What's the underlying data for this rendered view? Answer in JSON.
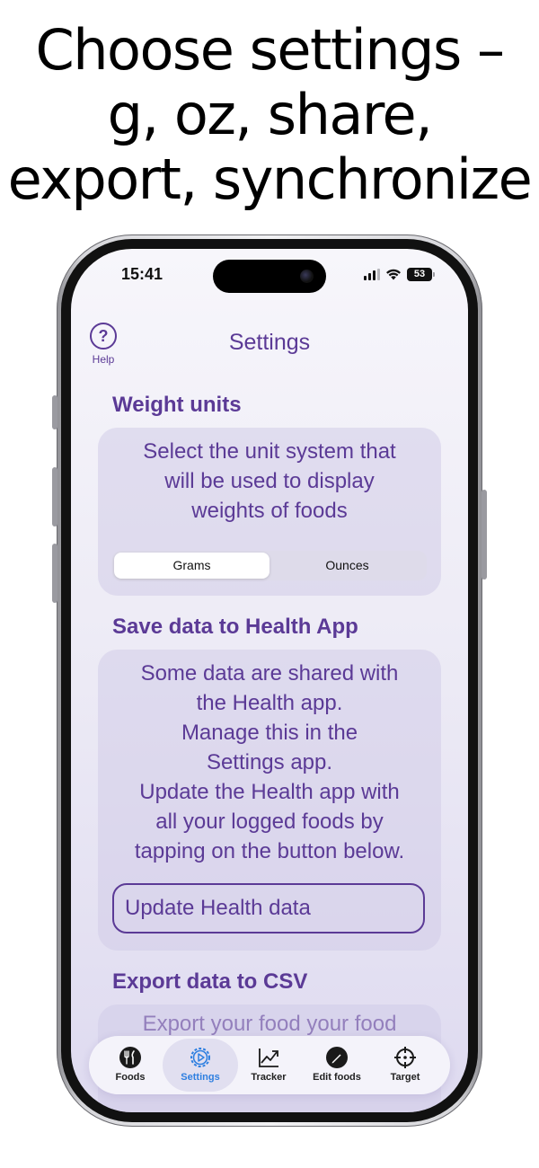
{
  "headline": {
    "line1": "Choose settings –",
    "line2": "g, oz, share,",
    "line3": "export, synchronize"
  },
  "status_bar": {
    "time": "15:41",
    "battery": "53"
  },
  "nav": {
    "help_label": "Help",
    "help_glyph": "?",
    "title": "Settings"
  },
  "weight_units": {
    "title": "Weight units",
    "description": [
      "Select the unit system that",
      "will be used to display",
      "weights of foods"
    ],
    "options": [
      "Grams",
      "Ounces"
    ],
    "selected": "Grams"
  },
  "health": {
    "title": "Save data to Health App",
    "description": [
      "Some data are shared with",
      "the Health app.",
      "Manage this in the",
      "Settings app.",
      "Update the Health app with",
      "all your logged foods by",
      "tapping on the button below."
    ],
    "button_label": "Update Health data"
  },
  "export": {
    "title": "Export data to CSV",
    "description_partial": "Export your food your food"
  },
  "tabs": [
    {
      "label": "Foods",
      "icon": "fork-knife-icon"
    },
    {
      "label": "Settings",
      "icon": "gear-icon",
      "active": true
    },
    {
      "label": "Tracker",
      "icon": "chart-up-icon"
    },
    {
      "label": "Edit foods",
      "icon": "pencil-circle-icon"
    },
    {
      "label": "Target",
      "icon": "target-icon"
    }
  ],
  "colors": {
    "accent": "#5b3a96",
    "active_tab": "#2e7fe0"
  }
}
